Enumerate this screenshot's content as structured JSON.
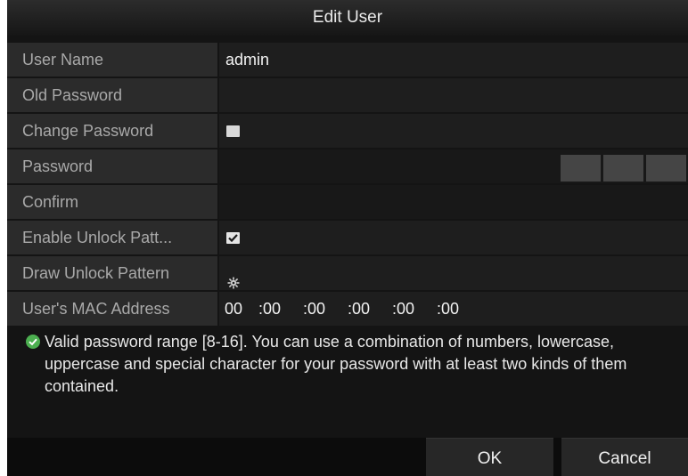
{
  "dialog": {
    "title": "Edit User"
  },
  "fields": {
    "user_name": {
      "label": "User Name",
      "value": "admin"
    },
    "old_password": {
      "label": "Old Password",
      "value": ""
    },
    "change_password": {
      "label": "Change Password",
      "checked": false
    },
    "password": {
      "label": "Password",
      "value": ""
    },
    "confirm": {
      "label": "Confirm",
      "value": ""
    },
    "enable_unlock_pattern": {
      "label": "Enable Unlock Patt...",
      "checked": true
    },
    "draw_unlock_pattern": {
      "label": "Draw Unlock Pattern",
      "icon": "gear-icon"
    },
    "mac_address": {
      "label": "User's MAC Address",
      "octets": [
        "00",
        ":00",
        ":00",
        ":00",
        ":00",
        ":00"
      ]
    }
  },
  "notice": {
    "icon": "check-circle-icon",
    "text": "Valid password range [8-16]. You can use a combination of numbers, lowercase, uppercase and special character for your password with at least two kinds of them contained."
  },
  "buttons": {
    "ok": "OK",
    "cancel": "Cancel"
  },
  "colors": {
    "accent_green": "#4caf50",
    "panel_bg": "#141414",
    "label_bg": "#2b2b2b",
    "label_text": "#a9a9a9"
  }
}
